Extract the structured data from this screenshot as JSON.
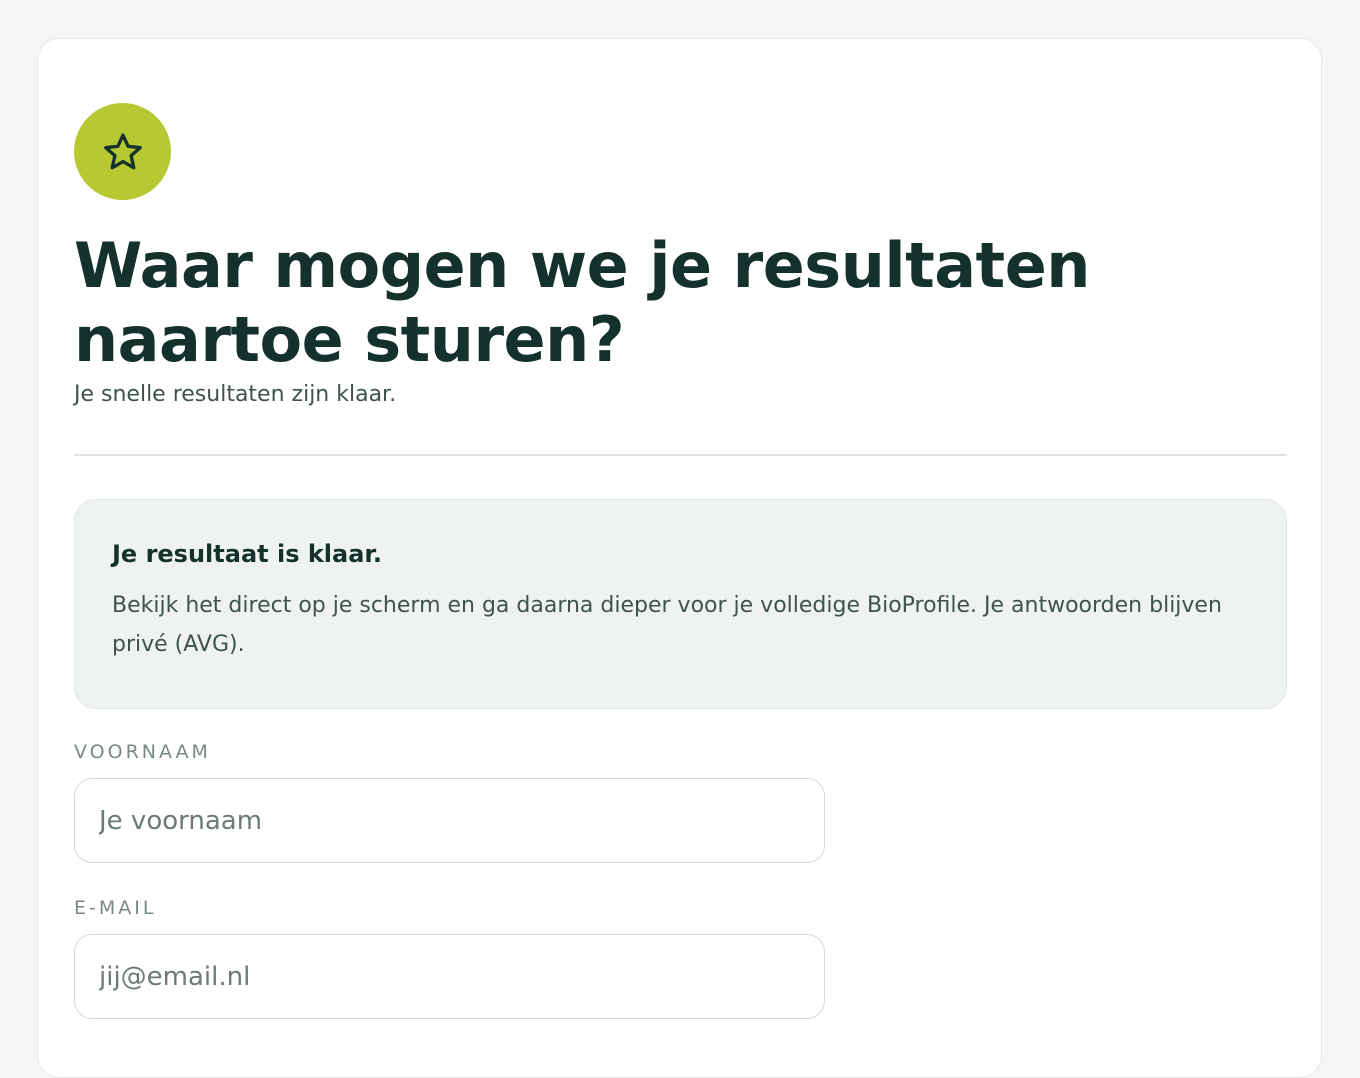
{
  "header": {
    "badge_icon": "star-icon",
    "badge_color": "#b6c932",
    "title": "Waar mogen we je resultaten naartoe sturen?",
    "subtitle": "Je snelle resultaten zijn klaar."
  },
  "info": {
    "title": "Je resultaat is klaar.",
    "text": "Bekijk het direct op je scherm en ga daarna dieper voor je volledige BioProfile. Je antwoorden blijven privé (AVG)."
  },
  "form": {
    "first_name": {
      "label": "VOORNAAM",
      "placeholder": "Je voornaam",
      "value": ""
    },
    "email": {
      "label": "E-MAIL",
      "placeholder": "jij@email.nl",
      "value": ""
    }
  },
  "colors": {
    "accent": "#b6c932",
    "text_dark": "#14312b",
    "background": "#f4f6f5"
  }
}
